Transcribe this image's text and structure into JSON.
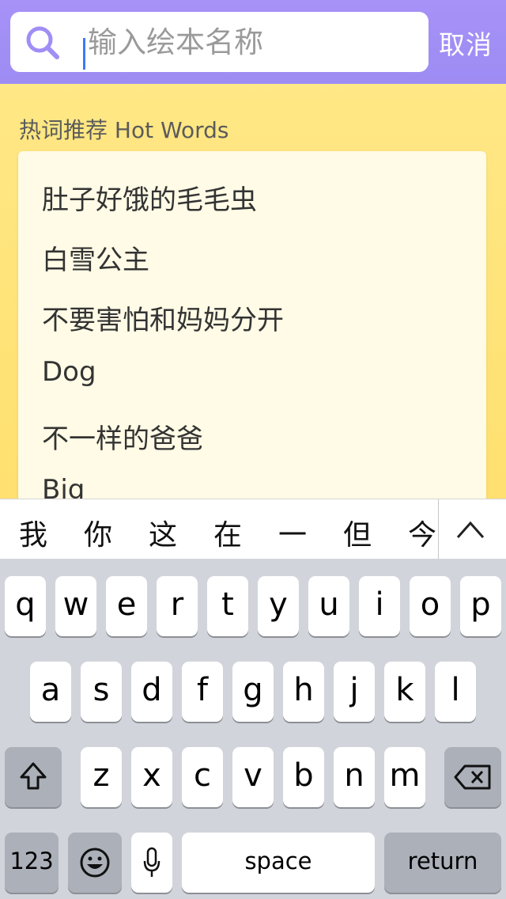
{
  "search": {
    "placeholder": "输入绘本名称",
    "value": "",
    "cancel_label": "取消",
    "icon": "search-icon"
  },
  "hot_words": {
    "title": "热词推荐 Hot Words",
    "items": [
      "肚子好饿的毛毛虫",
      "白雪公主",
      "不要害怕和妈妈分开",
      "Dog",
      "不一样的爸爸",
      "Big"
    ]
  },
  "keyboard": {
    "candidates": [
      "我",
      "你",
      "这",
      "在",
      "一",
      "但",
      "今"
    ],
    "collapse_icon": "chevron-up-icon",
    "row1": [
      "q",
      "w",
      "e",
      "r",
      "t",
      "y",
      "u",
      "i",
      "o",
      "p"
    ],
    "row2": [
      "a",
      "s",
      "d",
      "f",
      "g",
      "h",
      "j",
      "k",
      "l"
    ],
    "row3": [
      "z",
      "x",
      "c",
      "v",
      "b",
      "n",
      "m"
    ],
    "shift_icon": "shift-icon",
    "delete_icon": "backspace-icon",
    "numbers_label": "123",
    "emoji_icon": "emoji-icon",
    "mic_icon": "microphone-icon",
    "space_label": "space",
    "return_label": "return"
  },
  "colors": {
    "header": "#a08ef5",
    "background": "#ffe27a",
    "card": "#fffbe6",
    "keyboard": "#d1d4db",
    "accent_caret": "#3b7bf7"
  }
}
